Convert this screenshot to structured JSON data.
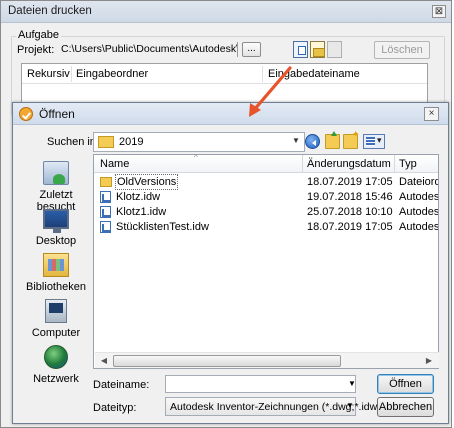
{
  "back_window": {
    "title": "Dateien drucken",
    "close_glyph": "⊠",
    "group_label": "Aufgabe",
    "projekt_label": "Projekt:",
    "projekt_path": "C:\\Users\\Public\\Documents\\Autodesk\\Inventor 2",
    "browse_label": "...",
    "delete_button": "Löschen",
    "table_columns": [
      "Rekursiv",
      "Eingabeordner",
      "Eingabedateiname"
    ]
  },
  "dialog": {
    "title": "Öffnen",
    "close_glyph": "×",
    "look_in_label": "Suchen in:",
    "look_in_value": "2019",
    "places": [
      {
        "label": "Zuletzt besucht",
        "icon": "recent-places-icon"
      },
      {
        "label": "Desktop",
        "icon": "desktop-icon"
      },
      {
        "label": "Bibliotheken",
        "icon": "libraries-icon"
      },
      {
        "label": "Computer",
        "icon": "computer-icon"
      },
      {
        "label": "Netzwerk",
        "icon": "network-icon"
      }
    ],
    "columns": [
      "Name",
      "Änderungsdatum",
      "Typ"
    ],
    "files": [
      {
        "name": "OldVersions",
        "date": "18.07.2019 17:05",
        "type": "Dateiordn",
        "icon": "folder-icon"
      },
      {
        "name": "Klotz.idw",
        "date": "19.07.2018 15:46",
        "type": "Autodesk",
        "icon": "idw-file-icon"
      },
      {
        "name": "Klotz1.idw",
        "date": "25.07.2018 10:10",
        "type": "Autodesk",
        "icon": "idw-file-icon"
      },
      {
        "name": "StücklistenTest.idw",
        "date": "18.07.2019 17:05",
        "type": "Autodesk",
        "icon": "idw-file-icon"
      }
    ],
    "filename_label": "Dateiname:",
    "filename_value": "",
    "filetype_label": "Dateityp:",
    "filetype_value": "Autodesk Inventor-Zeichnungen (*.dwg;*.idw)",
    "open_button": "Öffnen",
    "cancel_button": "Abbrechen"
  },
  "colors": {
    "arrow": "#e8532a",
    "selection_outline": "#6c6c6c"
  }
}
